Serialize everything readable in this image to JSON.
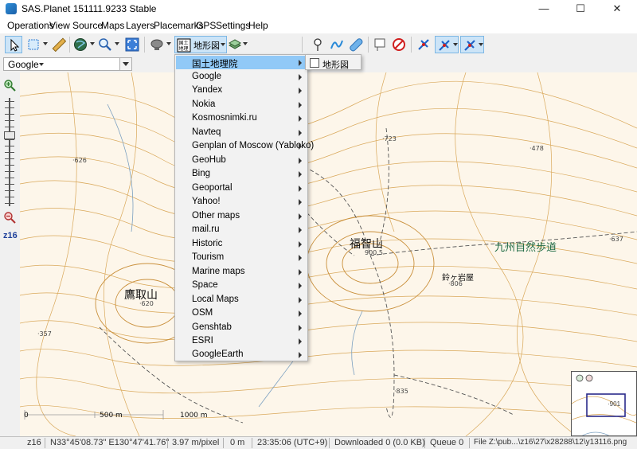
{
  "window": {
    "title": "SAS.Planet 151111.9233 Stable",
    "minimize": "—",
    "maximize": "☐",
    "close": "✕"
  },
  "menubar": [
    "Operations",
    "View",
    "Source",
    "Maps",
    "Layers",
    "Placemarks",
    "GPS",
    "Settings",
    "Help"
  ],
  "toolbar": {
    "map_button_label": "地形図",
    "icons": [
      "cursor-icon",
      "select-icon",
      "ruler-icon",
      "globe-icon",
      "zoom-icon",
      "fullscreen-icon",
      "source-icon",
      "map-type-icon",
      "layers-icon",
      "placemark-icon",
      "path-icon",
      "polygon-icon",
      "comment-icon",
      "no-entry-icon",
      "gps-icon",
      "gps-track-icon",
      "gps-center-icon"
    ]
  },
  "address_bar": {
    "geocoder": "Google"
  },
  "left_panel": {
    "zoom_label": "z16"
  },
  "maps_menu": {
    "items": [
      {
        "label": "国土地理院",
        "highlighted": true
      },
      {
        "label": "Google"
      },
      {
        "label": "Yandex"
      },
      {
        "label": "Nokia"
      },
      {
        "label": "Kosmosnimki.ru"
      },
      {
        "label": "Navteq"
      },
      {
        "label": "Genplan of Moscow (Yabloko)"
      },
      {
        "label": "GeoHub"
      },
      {
        "label": "Bing"
      },
      {
        "label": "Geoportal"
      },
      {
        "label": "Yahoo!"
      },
      {
        "label": "Other maps"
      },
      {
        "label": "mail.ru"
      },
      {
        "label": "Historic"
      },
      {
        "label": "Tourism"
      },
      {
        "label": "Marine maps"
      },
      {
        "label": "Space"
      },
      {
        "label": "Local Maps"
      },
      {
        "label": "OSM"
      },
      {
        "label": "Genshtab"
      },
      {
        "label": "ESRI"
      },
      {
        "label": "GoogleEarth"
      }
    ],
    "submenu": {
      "label": "地形図"
    }
  },
  "map": {
    "labels": {
      "mountain1": "福智山",
      "mountain2": "鷹取山",
      "trail": "九州自然歩道",
      "rock": "鈴ヶ岩屋"
    },
    "spot_heights": [
      "·723",
      "·478",
      "·626",
      "·637",
      "·620",
      "·357",
      "·806",
      "·835"
    ],
    "summit_height": "900.5",
    "scale": {
      "mid": "500 m",
      "end": "1000 m",
      "zero": "0"
    },
    "minimap_value": "·901"
  },
  "statusbar": {
    "zoom": "z16",
    "coordinates": "N33°45'08.73\"  E130°47'41.76\"",
    "resolution": "3.97 m/pixel",
    "distance": "0 m",
    "time": "23:35:06 (UTC+9)",
    "downloaded": "Downloaded 0 (0.0 KB)",
    "queue": "Queue 0",
    "file": "File Z:\\pub...\\z16\\27\\x28288\\12\\y13116.png"
  },
  "colors": {
    "highlight": "#91c9f7",
    "map_background": "#fdf6ea",
    "contour": "#d9a85a",
    "trail_label": "#1f6b45",
    "toolbar_pressed": "#cce4f7"
  }
}
